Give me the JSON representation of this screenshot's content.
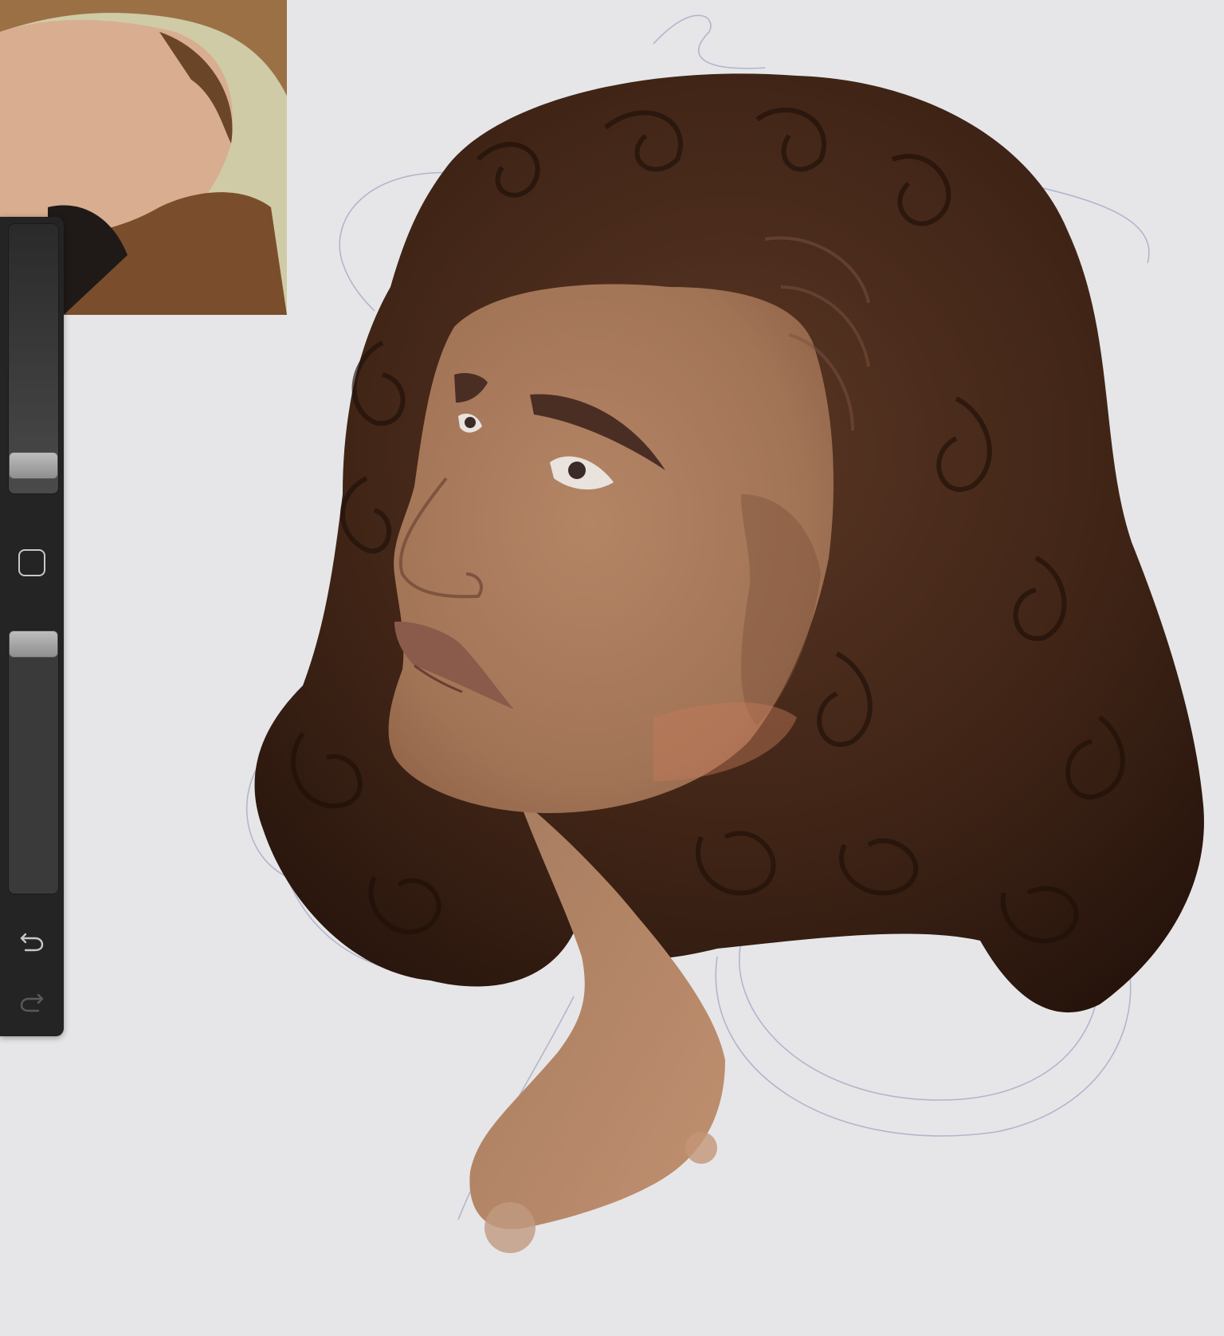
{
  "app": {
    "canvas_color": "#e6e6e8",
    "panel_color": "#242424"
  },
  "sidebar": {
    "brush_size_level": 0.15,
    "brush_opacity_level": 0.05,
    "icons": [
      "modify-square-icon",
      "undo-icon",
      "redo-icon"
    ]
  },
  "reference": {
    "icon": "reference-photo"
  },
  "artwork": {
    "skin_color": "#a97c5d",
    "hair_color": "#3f2416"
  }
}
